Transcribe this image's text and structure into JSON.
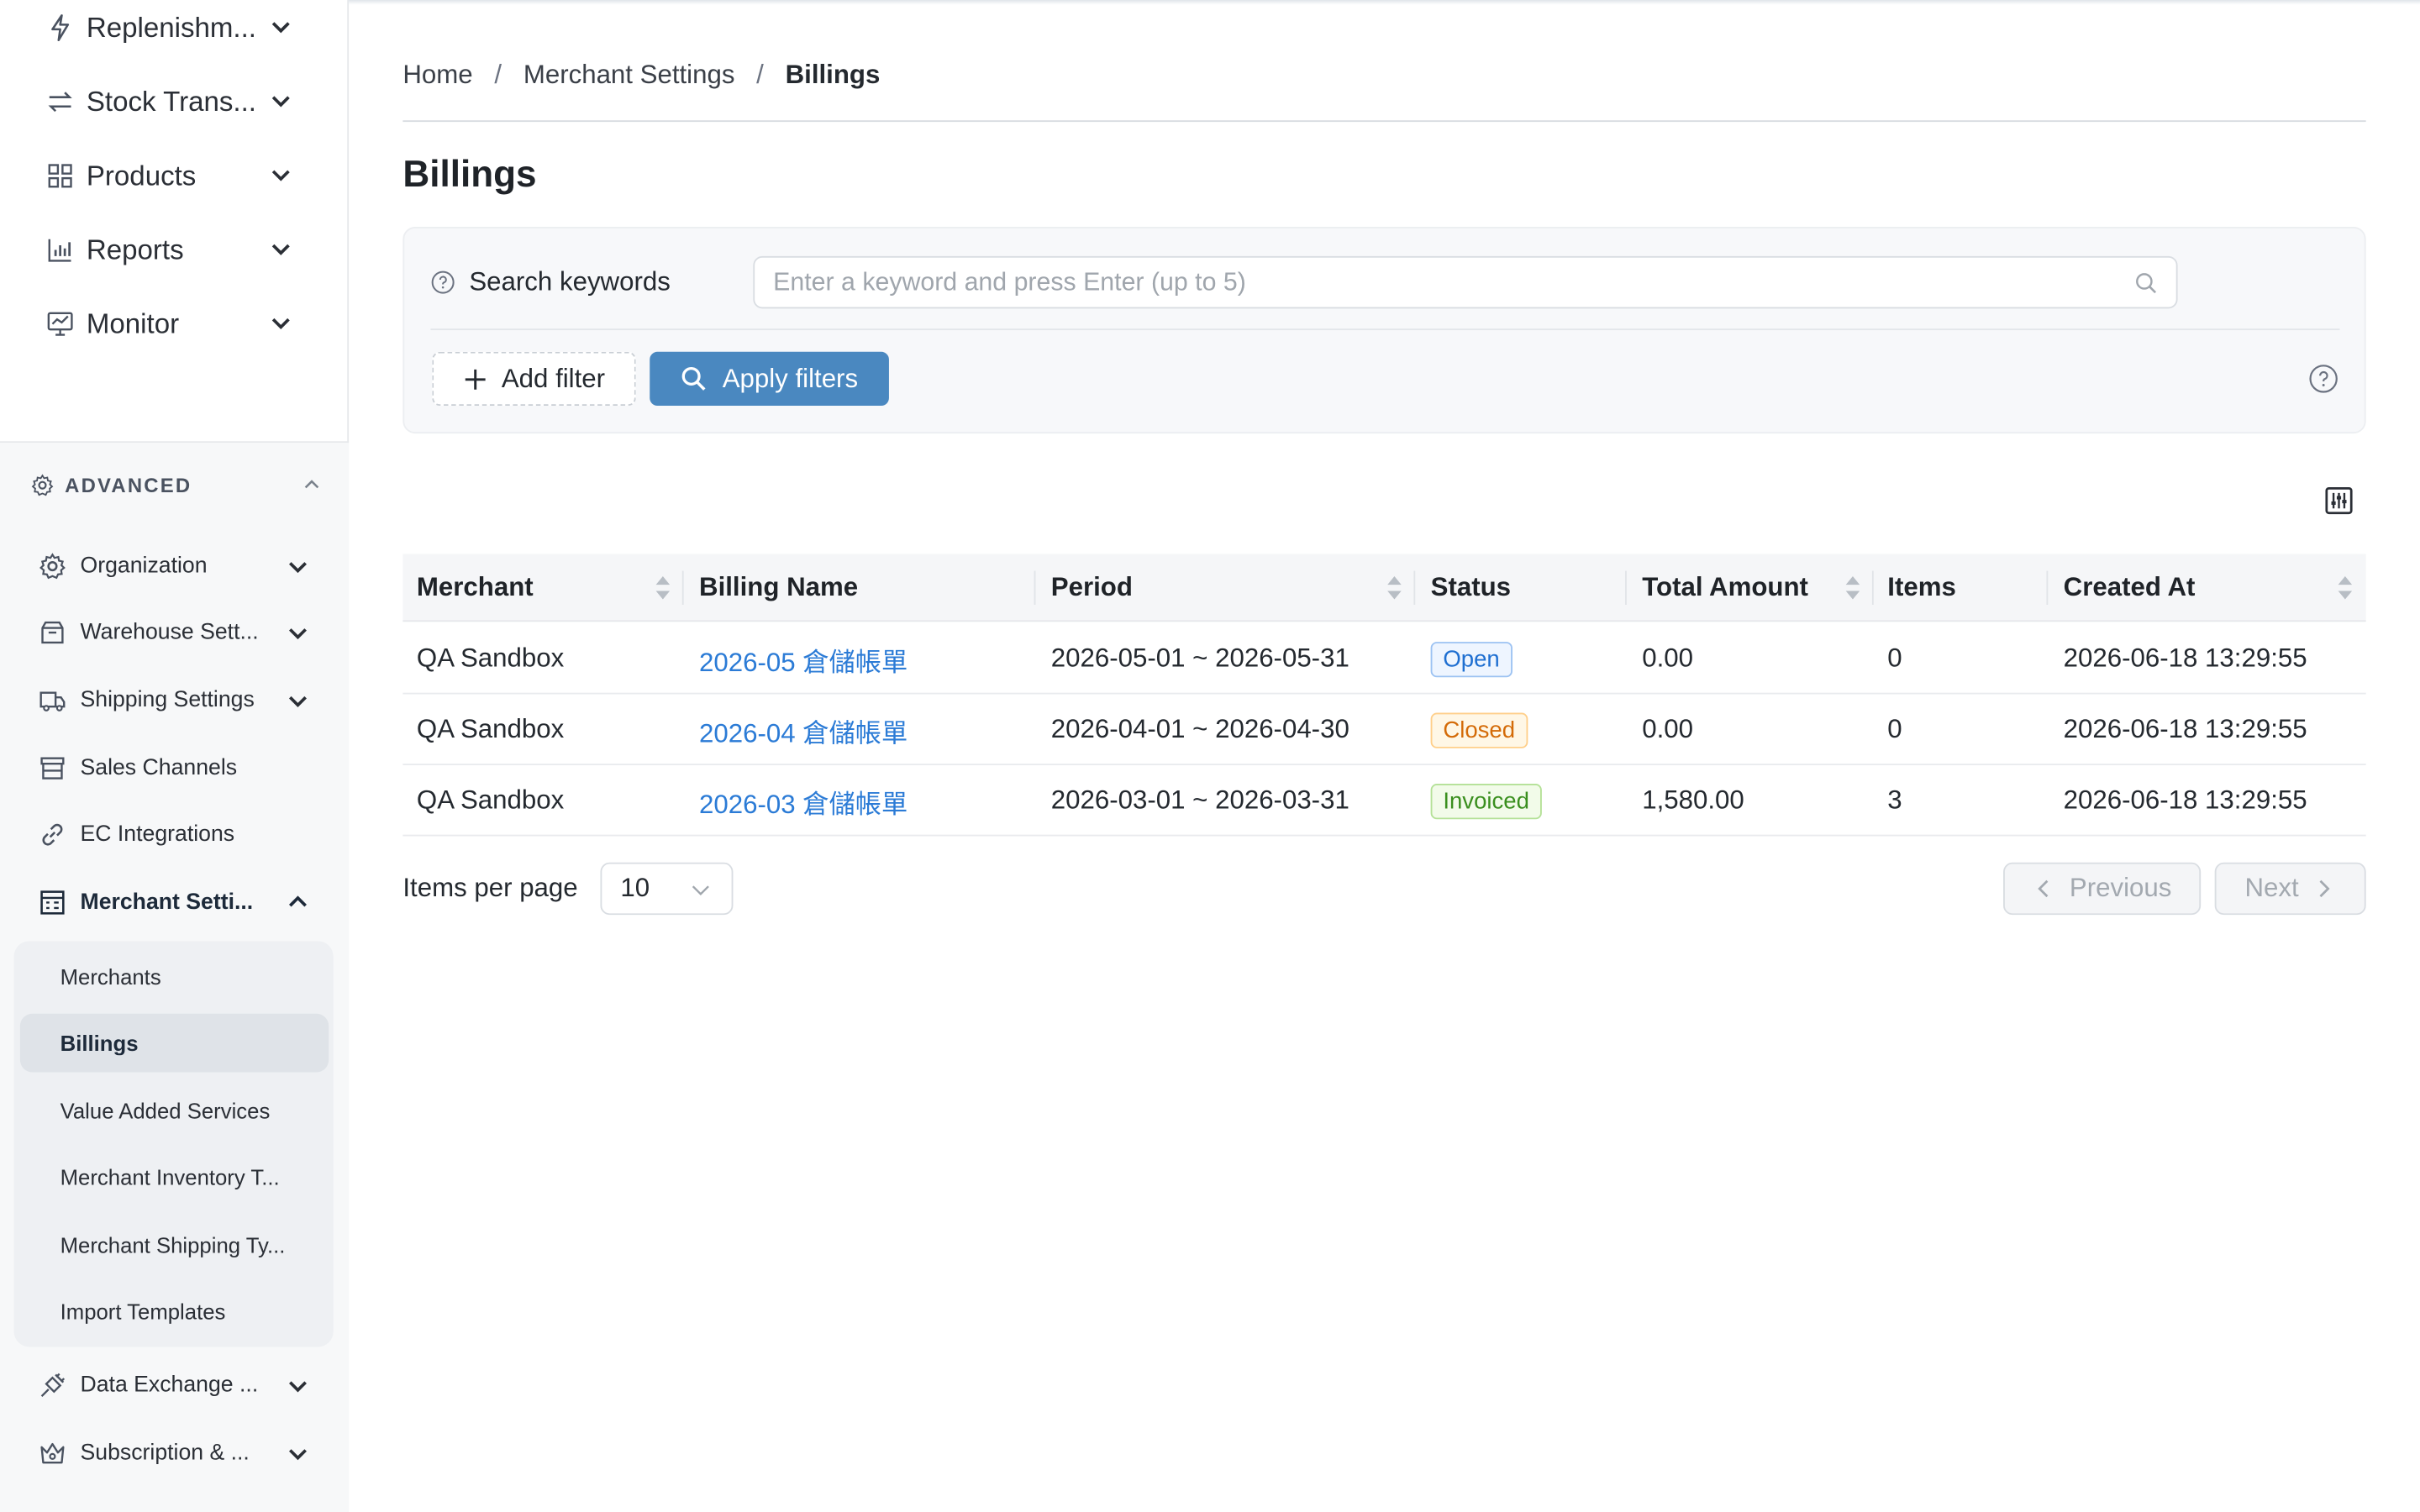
{
  "sidebar": {
    "top_items": [
      {
        "label": "Replenishm...",
        "icon": "lightning-icon"
      },
      {
        "label": "Stock Trans...",
        "icon": "transfer-arrows-icon"
      },
      {
        "label": "Products",
        "icon": "grid-icon"
      },
      {
        "label": "Reports",
        "icon": "bar-chart-icon"
      },
      {
        "label": "Monitor",
        "icon": "monitor-icon"
      }
    ],
    "advanced": {
      "label": "ADVANCED",
      "items": [
        {
          "label": "Organization",
          "icon": "gear-icon"
        },
        {
          "label": "Warehouse Sett...",
          "icon": "box-icon"
        },
        {
          "label": "Shipping Settings",
          "icon": "truck-icon"
        },
        {
          "label": "Sales Channels",
          "icon": "store-icon"
        },
        {
          "label": "EC Integrations",
          "icon": "link-icon"
        },
        {
          "label": "Merchant Setti...",
          "icon": "merchant-icon"
        },
        {
          "label": "Data Exchange ...",
          "icon": "plug-icon"
        },
        {
          "label": "Subscription & ...",
          "icon": "crown-icon"
        }
      ],
      "merchant_sub_items": [
        {
          "label": "Merchants"
        },
        {
          "label": "Billings"
        },
        {
          "label": "Value Added Services"
        },
        {
          "label": "Merchant Inventory T..."
        },
        {
          "label": "Merchant Shipping Ty..."
        },
        {
          "label": "Import Templates"
        }
      ]
    }
  },
  "breadcrumb": {
    "items": [
      "Home",
      "Merchant Settings",
      "Billings"
    ]
  },
  "page": {
    "title": "Billings"
  },
  "filters": {
    "search_label": "Search keywords",
    "search_placeholder": "Enter a keyword and press Enter (up to 5)",
    "add_filter": "Add filter",
    "apply_filters": "Apply filters"
  },
  "table": {
    "columns": [
      "Merchant",
      "Billing Name",
      "Period",
      "Status",
      "Total Amount",
      "Items",
      "Created At"
    ],
    "rows": [
      {
        "merchant": "QA Sandbox",
        "billing_name": "2026-05 倉儲帳單",
        "period": "2026-05-01 ~ 2026-05-31",
        "status": "Open",
        "total_amount": "0.00",
        "items": "0",
        "created_at": "2026-06-18 13:29:55"
      },
      {
        "merchant": "QA Sandbox",
        "billing_name": "2026-04 倉儲帳單",
        "period": "2026-04-01 ~ 2026-04-30",
        "status": "Closed",
        "total_amount": "0.00",
        "items": "0",
        "created_at": "2026-06-18 13:29:55"
      },
      {
        "merchant": "QA Sandbox",
        "billing_name": "2026-03 倉儲帳單",
        "period": "2026-03-01 ~ 2026-03-31",
        "status": "Invoiced",
        "total_amount": "1,580.00",
        "items": "3",
        "created_at": "2026-06-18 13:29:55"
      }
    ]
  },
  "pagination": {
    "items_per_page_label": "Items per page",
    "items_per_page_value": "10",
    "previous": "Previous",
    "next": "Next"
  },
  "colors": {
    "primary": "#4a88c0",
    "link": "#2b7bd6",
    "status_open": "#1f6fd1",
    "status_closed": "#d46b08",
    "status_invoiced": "#3a8f1e"
  }
}
